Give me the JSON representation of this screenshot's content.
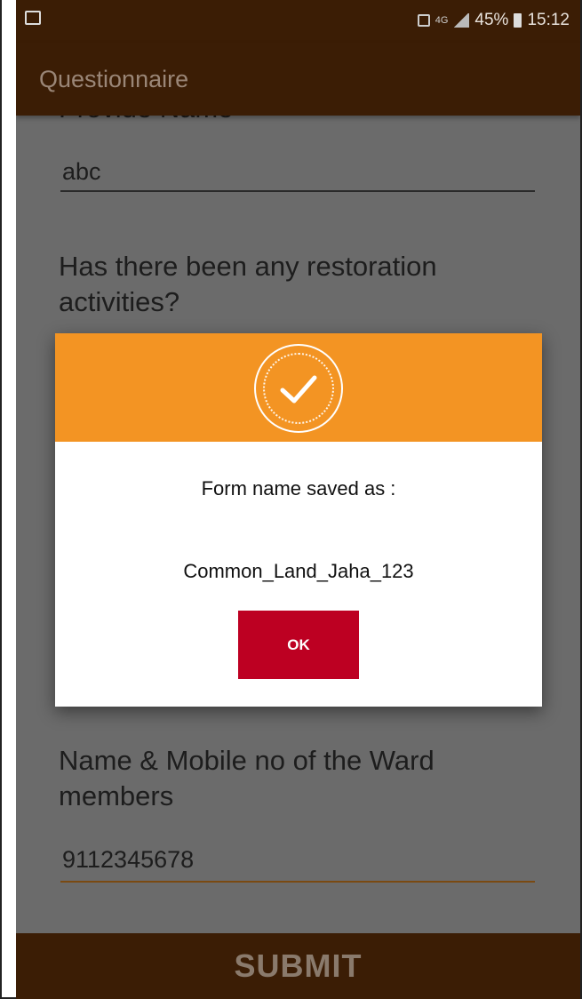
{
  "status_bar": {
    "battery_percent": "45%",
    "time": "15:12",
    "network_label": "4G"
  },
  "app_bar": {
    "title": "Questionnaire"
  },
  "form": {
    "partial_label": "Provide Name",
    "name_answer": "abc",
    "restoration_question": "Has there been any restoration activities?",
    "ward_question": "Name & Mobile no of the Ward members",
    "ward_answer": "9112345678"
  },
  "dialog": {
    "icon": "check-icon",
    "message": "Form name saved as :",
    "form_name": "Common_Land_Jaha_123",
    "ok_label": "OK"
  },
  "footer": {
    "submit_label": "SUBMIT"
  },
  "colors": {
    "app_bar": "#3b1d05",
    "dialog_header": "#f39423",
    "ok_button": "#bd0022",
    "overlay": "#6b6b6b"
  }
}
